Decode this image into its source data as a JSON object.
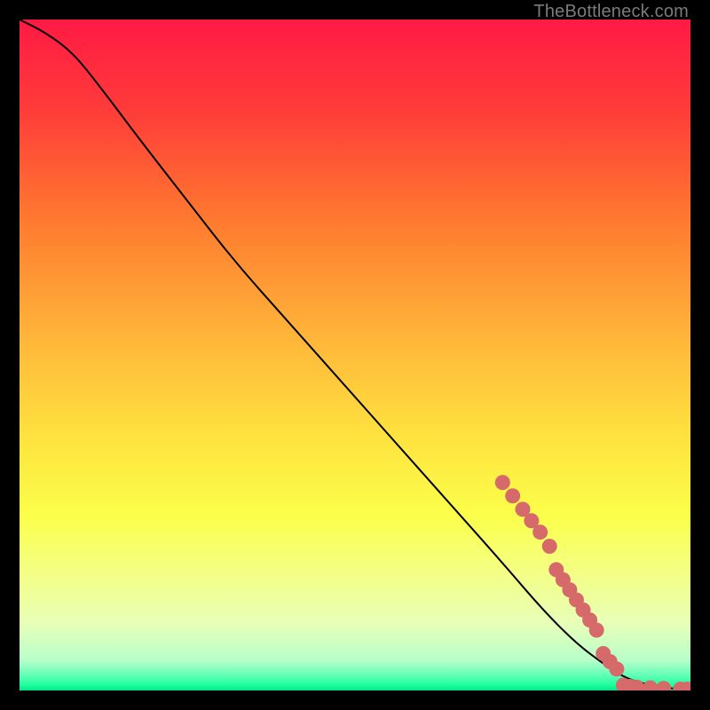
{
  "watermark": "TheBottleneck.com",
  "chart_data": {
    "type": "line",
    "title": "",
    "xlabel": "",
    "ylabel": "",
    "xlim": [
      0,
      100
    ],
    "ylim": [
      0,
      100
    ],
    "grid": false,
    "legend": false,
    "gradient_stops": [
      {
        "offset": 0,
        "color": "#ff1a44"
      },
      {
        "offset": 0.13,
        "color": "#ff3a3a"
      },
      {
        "offset": 0.3,
        "color": "#ff7a2f"
      },
      {
        "offset": 0.47,
        "color": "#ffb43a"
      },
      {
        "offset": 0.62,
        "color": "#ffe23f"
      },
      {
        "offset": 0.74,
        "color": "#fbff4a"
      },
      {
        "offset": 0.82,
        "color": "#f4ff82"
      },
      {
        "offset": 0.9,
        "color": "#e8ffb8"
      },
      {
        "offset": 0.955,
        "color": "#b8ffca"
      },
      {
        "offset": 0.978,
        "color": "#5fffb5"
      },
      {
        "offset": 0.992,
        "color": "#1fff9d"
      },
      {
        "offset": 1.0,
        "color": "#00e688"
      }
    ],
    "series": [
      {
        "name": "bottleneck-curve",
        "x": [
          0,
          4,
          8,
          12,
          18,
          25,
          32,
          40,
          48,
          56,
          64,
          72,
          78,
          83,
          87,
          90,
          93,
          96,
          98,
          100
        ],
        "y": [
          100,
          98,
          95,
          90,
          82,
          73,
          64,
          55,
          46,
          37,
          28,
          19,
          12,
          7,
          4,
          2,
          1,
          0.5,
          0.2,
          0.1
        ]
      }
    ],
    "markers": {
      "name": "highlighted-points",
      "color": "#d66a6a",
      "points": [
        {
          "x": 72.0,
          "y": 31.0
        },
        {
          "x": 73.5,
          "y": 29.0
        },
        {
          "x": 75.0,
          "y": 27.0
        },
        {
          "x": 76.3,
          "y": 25.3
        },
        {
          "x": 77.6,
          "y": 23.6
        },
        {
          "x": 79.0,
          "y": 21.5
        },
        {
          "x": 80.0,
          "y": 18.0
        },
        {
          "x": 81.0,
          "y": 16.5
        },
        {
          "x": 82.0,
          "y": 15.0
        },
        {
          "x": 83.0,
          "y": 13.5
        },
        {
          "x": 84.0,
          "y": 12.0
        },
        {
          "x": 85.0,
          "y": 10.5
        },
        {
          "x": 86.0,
          "y": 9.0
        },
        {
          "x": 87.0,
          "y": 5.5
        },
        {
          "x": 88.0,
          "y": 4.3
        },
        {
          "x": 89.0,
          "y": 3.2
        },
        {
          "x": 90.0,
          "y": 0.8
        },
        {
          "x": 91.0,
          "y": 0.6
        },
        {
          "x": 92.0,
          "y": 0.5
        },
        {
          "x": 94.0,
          "y": 0.4
        },
        {
          "x": 96.0,
          "y": 0.3
        },
        {
          "x": 98.5,
          "y": 0.2
        },
        {
          "x": 99.5,
          "y": 0.2
        }
      ]
    }
  }
}
